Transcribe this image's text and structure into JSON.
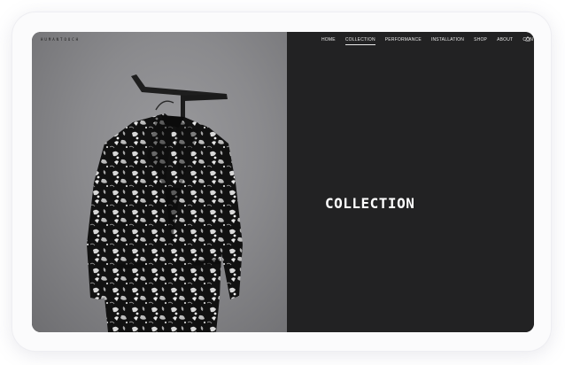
{
  "brand": {
    "name": "HUMANTOUCH"
  },
  "nav": {
    "items": [
      {
        "label": "HOME",
        "active": false
      },
      {
        "label": "COLLECTION",
        "active": true
      },
      {
        "label": "PERFORMANCE",
        "active": false
      },
      {
        "label": "INSTALLATION",
        "active": false
      },
      {
        "label": "SHOP",
        "active": false
      },
      {
        "label": "ABOUT",
        "active": false
      },
      {
        "label": "CONTACT",
        "active": false
      }
    ],
    "cart_icon": "shopping-bag-icon"
  },
  "hero": {
    "title": "COLLECTION"
  },
  "colors": {
    "dark_panel": "#222223",
    "photo_bg": "#8a8a8d",
    "text_light": "#ffffff"
  }
}
